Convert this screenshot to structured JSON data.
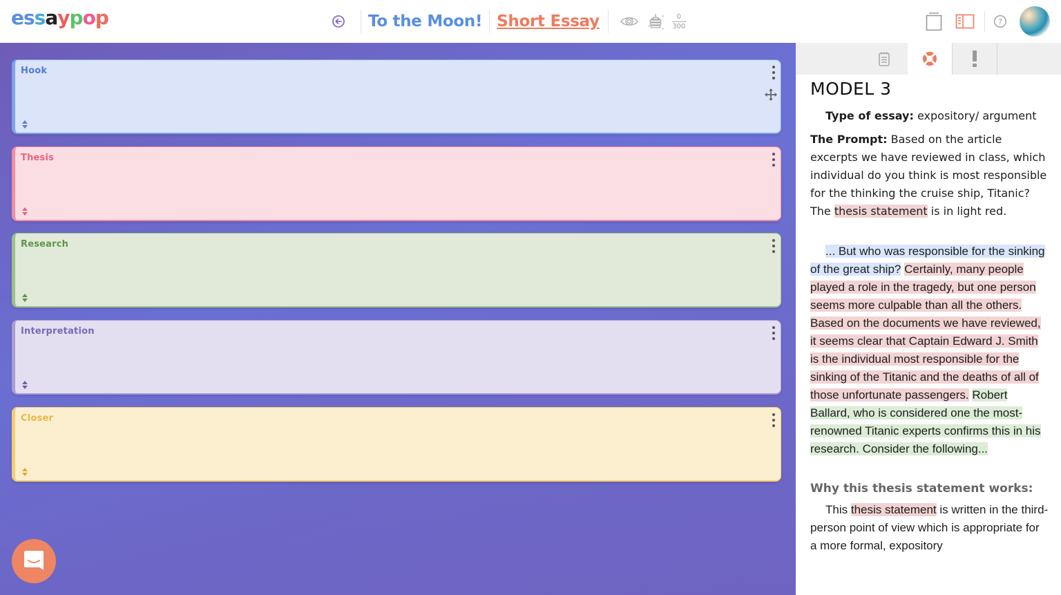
{
  "header": {
    "logo_letters": [
      {
        "ch": "e",
        "color": "#5b8ee0"
      },
      {
        "ch": "s",
        "color": "#5b8ee0"
      },
      {
        "ch": "s",
        "color": "#4aa7d6"
      },
      {
        "ch": "a",
        "color": "#222222"
      },
      {
        "ch": "y",
        "color": "#ef5b5b"
      },
      {
        "ch": "p",
        "color": "#5cc36a"
      },
      {
        "ch": "o",
        "color": "#ef5b8e"
      },
      {
        "ch": "p",
        "color": "#ef6b5b"
      }
    ],
    "logo_text": "essaypop",
    "project_title": "To the Moon!",
    "essay_type": "Short Essay",
    "word_count": "0",
    "word_limit": "300",
    "icons": {
      "back": "back-arrow-icon",
      "preview": "eye-icon",
      "stack": "stack-icon",
      "single_view": "single-page-icon",
      "split_view": "split-view-icon",
      "help": "help-icon"
    },
    "colors": {
      "title_blue": "#5b8ee0",
      "essay_orange": "#ef7b5e",
      "back_purple": "#7a5bbf"
    }
  },
  "sections": [
    {
      "label": "Hook",
      "label_color": "#4f7bd6",
      "bg": "#dbe4f8",
      "border": "#7ea4ea",
      "resize_color": "#5b7fcf"
    },
    {
      "label": "Thesis",
      "label_color": "#e8627c",
      "bg": "#fbdee4",
      "border": "#ef8fa2",
      "resize_color": "#e8627c"
    },
    {
      "label": "Research",
      "label_color": "#5f9448",
      "bg": "#e1ead9",
      "border": "#9cc08a",
      "resize_color": "#5f9448"
    },
    {
      "label": "Interpretation",
      "label_color": "#7a68b8",
      "bg": "#e3dff0",
      "border": "#a99dd2",
      "resize_color": "#6e5cb0"
    },
    {
      "label": "Closer",
      "label_color": "#e8b842",
      "bg": "#fbefd0",
      "border": "#f1cd73",
      "resize_color": "#e0a830"
    }
  ],
  "chat_button": {
    "icon": "chat-icon",
    "color": "#ee8563"
  },
  "panel": {
    "tabs": [
      {
        "name": "notes",
        "icon": "notepad-icon",
        "active": false
      },
      {
        "name": "help",
        "icon": "lifebuoy-icon",
        "active": true
      },
      {
        "name": "alerts",
        "icon": "exclamation-icon",
        "active": false
      }
    ],
    "model_title": "MODEL 3",
    "type_label": "Type of essay:",
    "type_value": "expository/ argument",
    "prompt_label": "The Prompt:",
    "prompt_text_1": "Based on the article excerpts we have reviewed in class, which individual do you think is most responsible for the thinking the cruise ship, Titanic? The",
    "prompt_highlight": "thesis statement",
    "prompt_text_2": "is in light red.",
    "excerpt_hook": "... But who was responsible for the sinking of the great ship?",
    "excerpt_thesis": "Certainly, many people played a role in the tragedy, but one person seems more culpable than all the others. Based on the documents we have reviewed, it seems clear that Captain Edward J. Smith is the individual most responsible for the sinking of the Titanic and the deaths of all of those unfortunate passengers.",
    "excerpt_research": "Robert Ballard, who is considered one the most-renowned Titanic experts confirms this in his research. Consider the following...",
    "why_title": "Why this thesis statement works:",
    "why_text_1": "This",
    "why_highlight": "thesis statement",
    "why_text_2": "is written in the third-person point of view which is appropriate for a more formal, expository"
  }
}
